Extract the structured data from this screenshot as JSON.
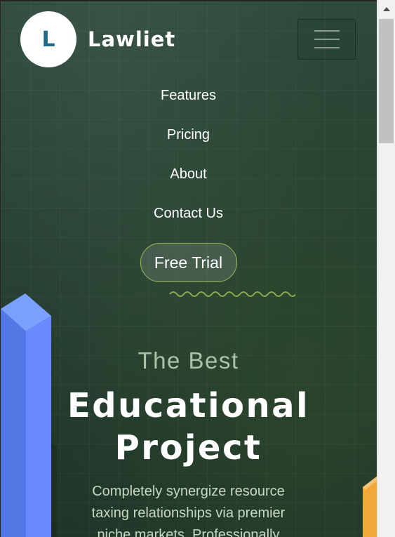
{
  "header": {
    "logo_letter": "L",
    "logo_text": "Lawliet",
    "menu_toggle_icon": "hamburger-icon"
  },
  "nav": {
    "items": [
      {
        "label": "Features"
      },
      {
        "label": "Pricing"
      },
      {
        "label": "About"
      },
      {
        "label": "Contact Us"
      }
    ],
    "cta_label": "Free Trial"
  },
  "hero": {
    "subtitle": "The Best",
    "title_line1": "Educational",
    "title_line2": "Project",
    "description": "Completely synergize resource taxing relationships via premier niche markets. Professionally"
  },
  "colors": {
    "background": "#253f31",
    "accent": "#9fb85a",
    "logo_letter": "#1f6a8a",
    "subtitle": "#a9c4a8",
    "deco_blue": "#6a8bff",
    "deco_orange": "#f2a93b"
  }
}
